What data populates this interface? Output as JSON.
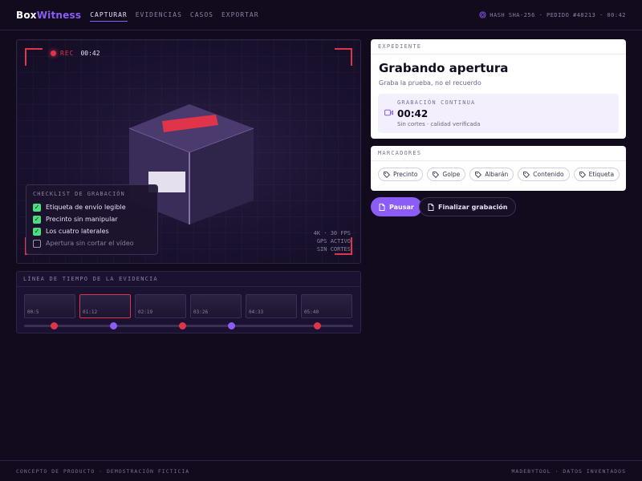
{
  "brand": {
    "part1": "Box",
    "part2": "Witness"
  },
  "nav": [
    {
      "label": "CAPTURAR",
      "active": true
    },
    {
      "label": "EVIDENCIAS",
      "active": false
    },
    {
      "label": "CASOS",
      "active": false
    },
    {
      "label": "EXPORTAR",
      "active": false
    }
  ],
  "header": {
    "hash_info": "HASH SHA-256 · PEDIDO #48213 · 00:42"
  },
  "camera": {
    "rec_label": "REC",
    "rec_time": "00:42",
    "stats": [
      "4K · 30 FPS",
      "GPS ACTIVO",
      "SIN CORTES"
    ]
  },
  "checklist": {
    "title": "CHECKLIST DE GRABACIÓN",
    "items": [
      {
        "label": "Etiqueta de envío legible",
        "checked": true
      },
      {
        "label": "Precinto sin manipular",
        "checked": true
      },
      {
        "label": "Los cuatro laterales",
        "checked": true
      },
      {
        "label": "Apertura sin cortar el vídeo",
        "checked": false
      }
    ]
  },
  "timeline": {
    "title": "LÍNEA DE TIEMPO DE LA EVIDENCIA",
    "clips": [
      {
        "time": "00:5",
        "selected": false
      },
      {
        "time": "01:12",
        "selected": true
      },
      {
        "time": "02:19",
        "selected": false
      },
      {
        "time": "03:26",
        "selected": false
      },
      {
        "time": "04:33",
        "selected": false
      },
      {
        "time": "05:40",
        "selected": false
      }
    ],
    "markers": [
      {
        "pos": 0.09,
        "color": "red"
      },
      {
        "pos": 0.27,
        "color": "purple"
      },
      {
        "pos": 0.48,
        "color": "red"
      },
      {
        "pos": 0.63,
        "color": "purple"
      },
      {
        "pos": 0.89,
        "color": "red"
      }
    ]
  },
  "expediente": {
    "head": "EXPEDIENTE",
    "title": "Grabando apertura",
    "subtitle": "Graba la prueba, no el recuerdo",
    "rec_label": "GRABACIÓN CONTINUA",
    "rec_time": "00:42",
    "rec_sub": "Sin cortes · calidad verificada"
  },
  "marcadores": {
    "head": "MARCADORES",
    "chips": [
      "Precinto",
      "Golpe",
      "Albarán",
      "Contenido",
      "Etiqueta"
    ]
  },
  "actions": {
    "pause": "Pausar",
    "finish": "Finalizar grabación"
  },
  "footer": {
    "left": "CONCEPTO DE PRODUCTO · DEMOSTRACIÓN FICTICIA",
    "right": "MADEBYTOOL · DATOS INVENTADOS"
  },
  "colors": {
    "accent": "#8b5cf6",
    "rec": "#e0344a",
    "ok": "#4ade80",
    "bg": "#120b1e"
  }
}
